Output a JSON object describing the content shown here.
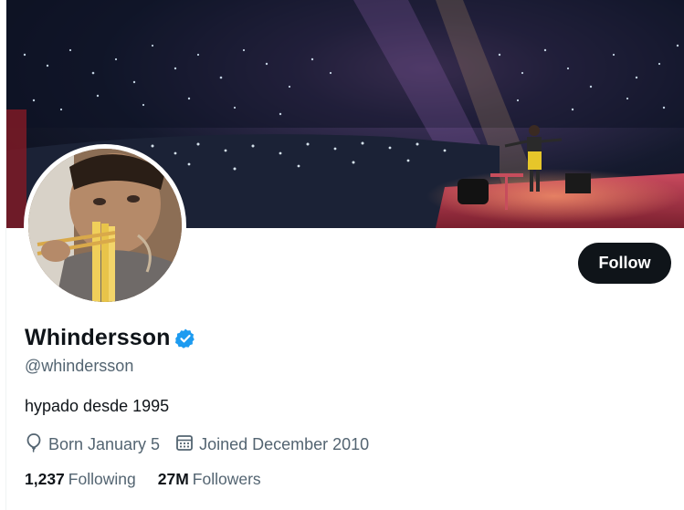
{
  "profile": {
    "display_name": "Whindersson",
    "handle": "@whindersson",
    "verified": true,
    "bio": "hypado desde 1995",
    "birthday": "Born January 5",
    "joined": "Joined December 2010",
    "following_count": "1,237",
    "following_label": "Following",
    "followers_count": "27M",
    "followers_label": "Followers"
  },
  "actions": {
    "follow_label": "Follow"
  },
  "icons": {
    "verified": "verified-badge-icon",
    "birthday": "balloon-icon",
    "joined": "calendar-icon"
  },
  "colors": {
    "text_primary": "#0f1419",
    "text_secondary": "#536471",
    "verified_blue": "#1d9bf0",
    "button_bg": "#0f1419"
  }
}
